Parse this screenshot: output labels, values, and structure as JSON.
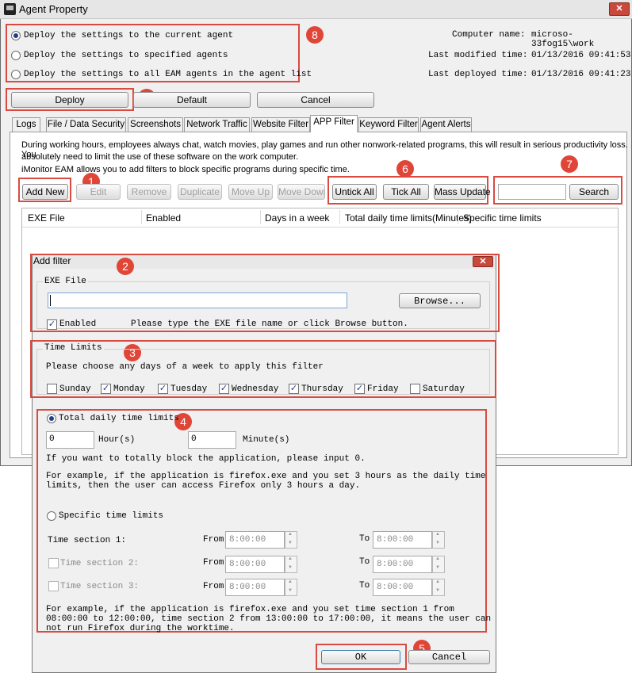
{
  "window": {
    "title": "Agent Property",
    "close_glyph": "✕"
  },
  "deploy_options": [
    {
      "label": "Deploy the settings to the current agent",
      "selected": true
    },
    {
      "label": "Deploy the settings to specified agents",
      "selected": false
    },
    {
      "label": "Deploy the settings to all EAM agents in the agent list",
      "selected": false
    }
  ],
  "info": {
    "computer_name_label": "Computer name:",
    "computer_name": "microso-33fog15\\work",
    "last_modified_label": "Last modified time:",
    "last_modified": "01/13/2016 09:41:53",
    "last_deployed_label": "Last deployed time:",
    "last_deployed": "01/13/2016 09:41:23"
  },
  "actions": {
    "deploy": "Deploy",
    "default": "Default",
    "cancel": "Cancel"
  },
  "tabs": [
    "Logs",
    "File / Data Security",
    "Screenshots",
    "Network Traffic",
    "Website Filter",
    "APP Filter",
    "Keyword Filter",
    "Agent Alerts"
  ],
  "active_tab": "APP Filter",
  "description": {
    "line1": "During working hours, employees always chat,  watch movies, play games and run other nonwork-related programs, this will result in serious productivity loss. You",
    "line2": "absolutely need to limit the use of these software on the work computer.",
    "line3": "iMonitor EAM allows you to add filters to block specific programs during specific time."
  },
  "toolbar": {
    "add_new": "Add New",
    "edit": "Edit",
    "remove": "Remove",
    "duplicate": "Duplicate",
    "move_up": "Move Up",
    "move_down": "Move Down",
    "untick_all": "Untick All",
    "tick_all": "Tick All",
    "mass_update": "Mass Update",
    "search_value": "",
    "search": "Search"
  },
  "table": {
    "columns": [
      "EXE File",
      "Enabled",
      "Days in a week",
      "Total daily time limits(Minutes)",
      "Specific time limits"
    ]
  },
  "dialog": {
    "title": "Add filter",
    "exe_group": "EXE File",
    "exe_value": "",
    "browse": "Browse...",
    "enabled_label": "Enabled",
    "exe_hint": "Please type the EXE file name or click Browse button.",
    "time_group": "Time Limits",
    "days_hint": "Please choose any days of a week to apply this filter",
    "days": [
      {
        "label": "Sunday",
        "checked": false
      },
      {
        "label": "Monday",
        "checked": true
      },
      {
        "label": "Tuesday",
        "checked": true
      },
      {
        "label": "Wednesday",
        "checked": true
      },
      {
        "label": "Thursday",
        "checked": true
      },
      {
        "label": "Friday",
        "checked": true
      },
      {
        "label": "Saturday",
        "checked": false
      }
    ],
    "total_limits_label": "Total daily time limits",
    "hours_value": "0",
    "hours_unit": "Hour(s)",
    "minutes_value": "0",
    "minutes_unit": "Minute(s)",
    "block_hint": "If you want to totally block the application, please input 0.",
    "example1_line1": "For example, if the application is firefox.exe and you set 3 hours  as the daily time",
    "example1_line2": "limits, then the user can access Firefox only 3 hours a day.",
    "specific_limits_label": "Specific time limits",
    "sections": [
      {
        "label": "Time section 1:",
        "from": "8:00:00",
        "to": "8:00:00"
      },
      {
        "label": "Time section 2:",
        "from": "8:00:00",
        "to": "8:00:00"
      },
      {
        "label": "Time section 3:",
        "from": "8:00:00",
        "to": "8:00:00"
      }
    ],
    "from_label": "From",
    "to_label": "To",
    "example2_line1": "For example, if the application is firefox.exe and you set  time section 1 from",
    "example2_line2": "08:00:00 to 12:00:00, time section 2 from 13:00:00 to 17:00:00, it means the user can",
    "example2_line3": "not run Firefox during the worktime.",
    "ok": "OK",
    "cancel": "Cancel"
  },
  "badges": [
    "1",
    "2",
    "3",
    "4",
    "5",
    "6",
    "7",
    "8",
    "9"
  ],
  "colors": {
    "annotation": "#d94b41",
    "badge": "#e04638"
  }
}
